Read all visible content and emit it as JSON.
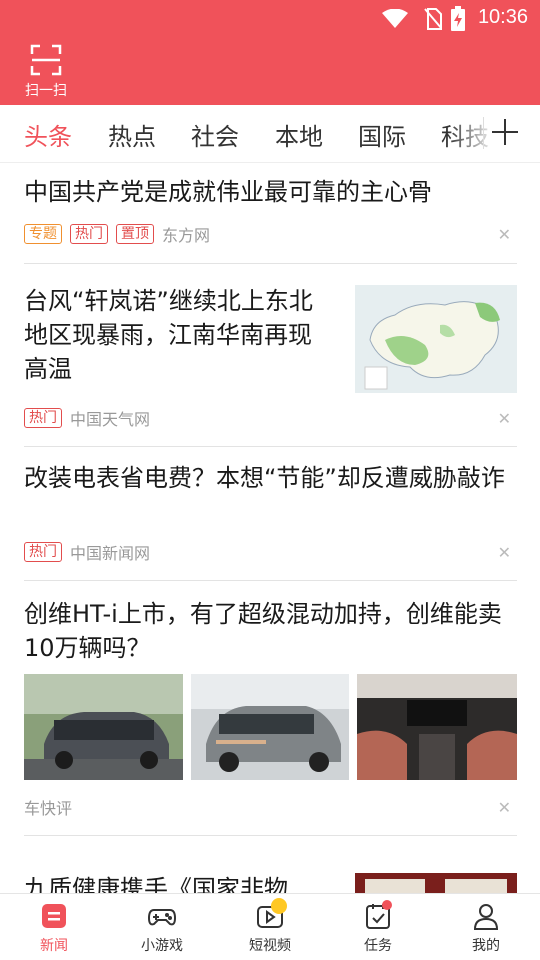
{
  "status_bar": {
    "time": "10:36"
  },
  "header": {
    "scan_label": "扫一扫"
  },
  "tabs": [
    "头条",
    "热点",
    "社会",
    "本地",
    "国际",
    "科技"
  ],
  "articles": [
    {
      "title": "中国共产党是成就伟业最可靠的主心骨",
      "tags": [
        "专题",
        "热门",
        "置顶"
      ],
      "source": "东方网"
    },
    {
      "title": "台风“轩岚诺”继续北上东北地区现暴雨，江南华南再现高温",
      "tags": [
        "热门"
      ],
      "source": "中国天气网"
    },
    {
      "title": "改装电表省电费？本想“节能”却反遭威胁敲诈",
      "tags": [
        "热门"
      ],
      "source": "中国新闻网"
    },
    {
      "title": "创维HT-i上市，有了超级混动加持，创维能卖10万辆吗？",
      "tags": [],
      "source": "车快评"
    },
    {
      "title": "九质健康携手《国家非物",
      "tags": [],
      "source": ""
    }
  ],
  "bottom_nav": [
    {
      "label": "新闻",
      "icon": "news-icon"
    },
    {
      "label": "小游戏",
      "icon": "gamepad-icon"
    },
    {
      "label": "短视频",
      "icon": "video-play-icon"
    },
    {
      "label": "任务",
      "icon": "task-clipboard-icon"
    },
    {
      "label": "我的",
      "icon": "person-icon"
    }
  ],
  "colors": {
    "brand": "#f0525a",
    "tag_red": "#e24d4d",
    "tag_orange": "#f0902f"
  }
}
